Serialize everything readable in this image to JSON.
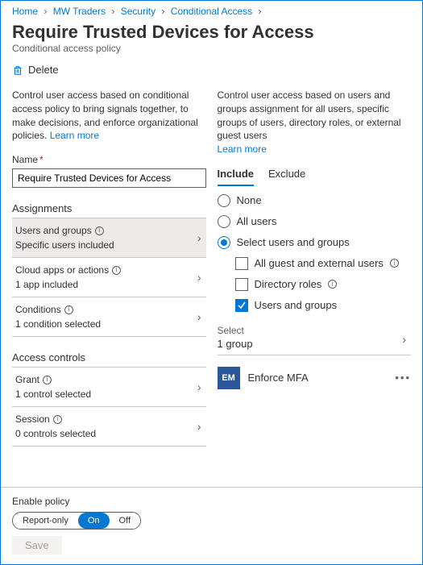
{
  "breadcrumb": [
    {
      "label": "Home"
    },
    {
      "label": "MW Traders"
    },
    {
      "label": "Security"
    },
    {
      "label": "Conditional Access"
    },
    {
      "label": ""
    }
  ],
  "page": {
    "title": "Require Trusted Devices for Access",
    "subtitle": "Conditional access policy"
  },
  "actions": {
    "delete": "Delete"
  },
  "left": {
    "description": "Control user access based on conditional access policy to bring signals together, to make decisions, and enforce organizational policies. ",
    "learn_more": "Learn more",
    "name_label": "Name",
    "name_value": "Require Trusted Devices for Access"
  },
  "right": {
    "description": "Control user access based on users and groups assignment for all users, specific groups of users, directory roles, or external guest users",
    "learn_more": "Learn more"
  },
  "assignments": {
    "heading": "Assignments",
    "items": [
      {
        "label": "Users and groups",
        "value": "Specific users included",
        "selected": true
      },
      {
        "label": "Cloud apps or actions",
        "value": "1 app included",
        "selected": false
      },
      {
        "label": "Conditions",
        "value": "1 condition selected",
        "selected": false
      }
    ]
  },
  "access_controls": {
    "heading": "Access controls",
    "items": [
      {
        "label": "Grant",
        "value": "1 control selected"
      },
      {
        "label": "Session",
        "value": "0 controls selected"
      }
    ]
  },
  "users_panel": {
    "tabs": {
      "include": "Include",
      "exclude": "Exclude"
    },
    "radios": {
      "none": "None",
      "all": "All users",
      "select": "Select users and groups"
    },
    "checks": {
      "guests": "All guest and external users",
      "roles": "Directory roles",
      "groups": "Users and groups"
    },
    "select_label": "Select",
    "select_value": "1 group",
    "group": {
      "initials": "EM",
      "name": "Enforce MFA"
    }
  },
  "footer": {
    "enable_label": "Enable policy",
    "segments": {
      "report": "Report-only",
      "on": "On",
      "off": "Off"
    },
    "save": "Save"
  }
}
